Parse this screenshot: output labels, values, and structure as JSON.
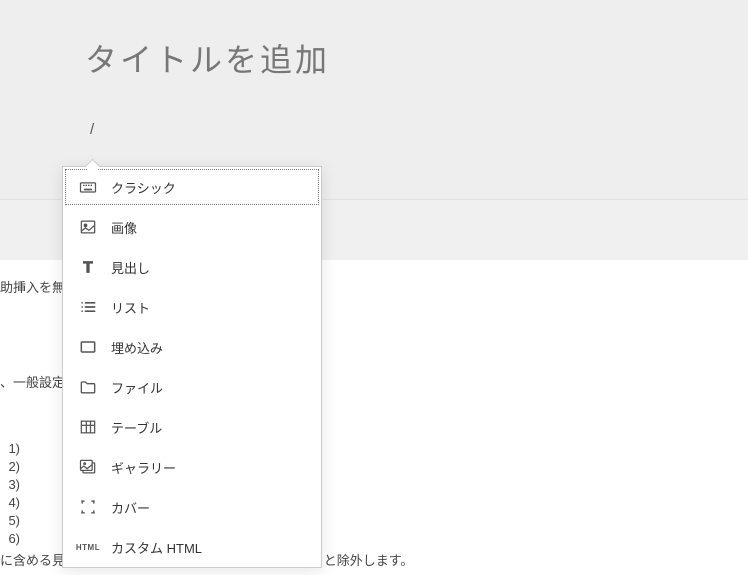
{
  "title_placeholder": "タイトルを追加",
  "slash": "/",
  "blocks": [
    {
      "label": "クラシック",
      "icon": "keyboard"
    },
    {
      "label": "画像",
      "icon": "image"
    },
    {
      "label": "見出し",
      "icon": "heading"
    },
    {
      "label": "リスト",
      "icon": "list"
    },
    {
      "label": "埋め込み",
      "icon": "embed"
    },
    {
      "label": "ファイル",
      "icon": "file"
    },
    {
      "label": "テーブル",
      "icon": "table"
    },
    {
      "label": "ギャラリー",
      "icon": "gallery"
    },
    {
      "label": "カバー",
      "icon": "cover"
    },
    {
      "label": "カスタム HTML",
      "icon": "html"
    }
  ],
  "bg": {
    "text1": "助挿入を無",
    "text2": "、一般設定",
    "headings": [
      "1)",
      "2)",
      "3)",
      "4)",
      "5)",
      "6)"
    ],
    "bottom": "に含める見出しを選択します。見出しの選択を解除すると除外します。"
  }
}
